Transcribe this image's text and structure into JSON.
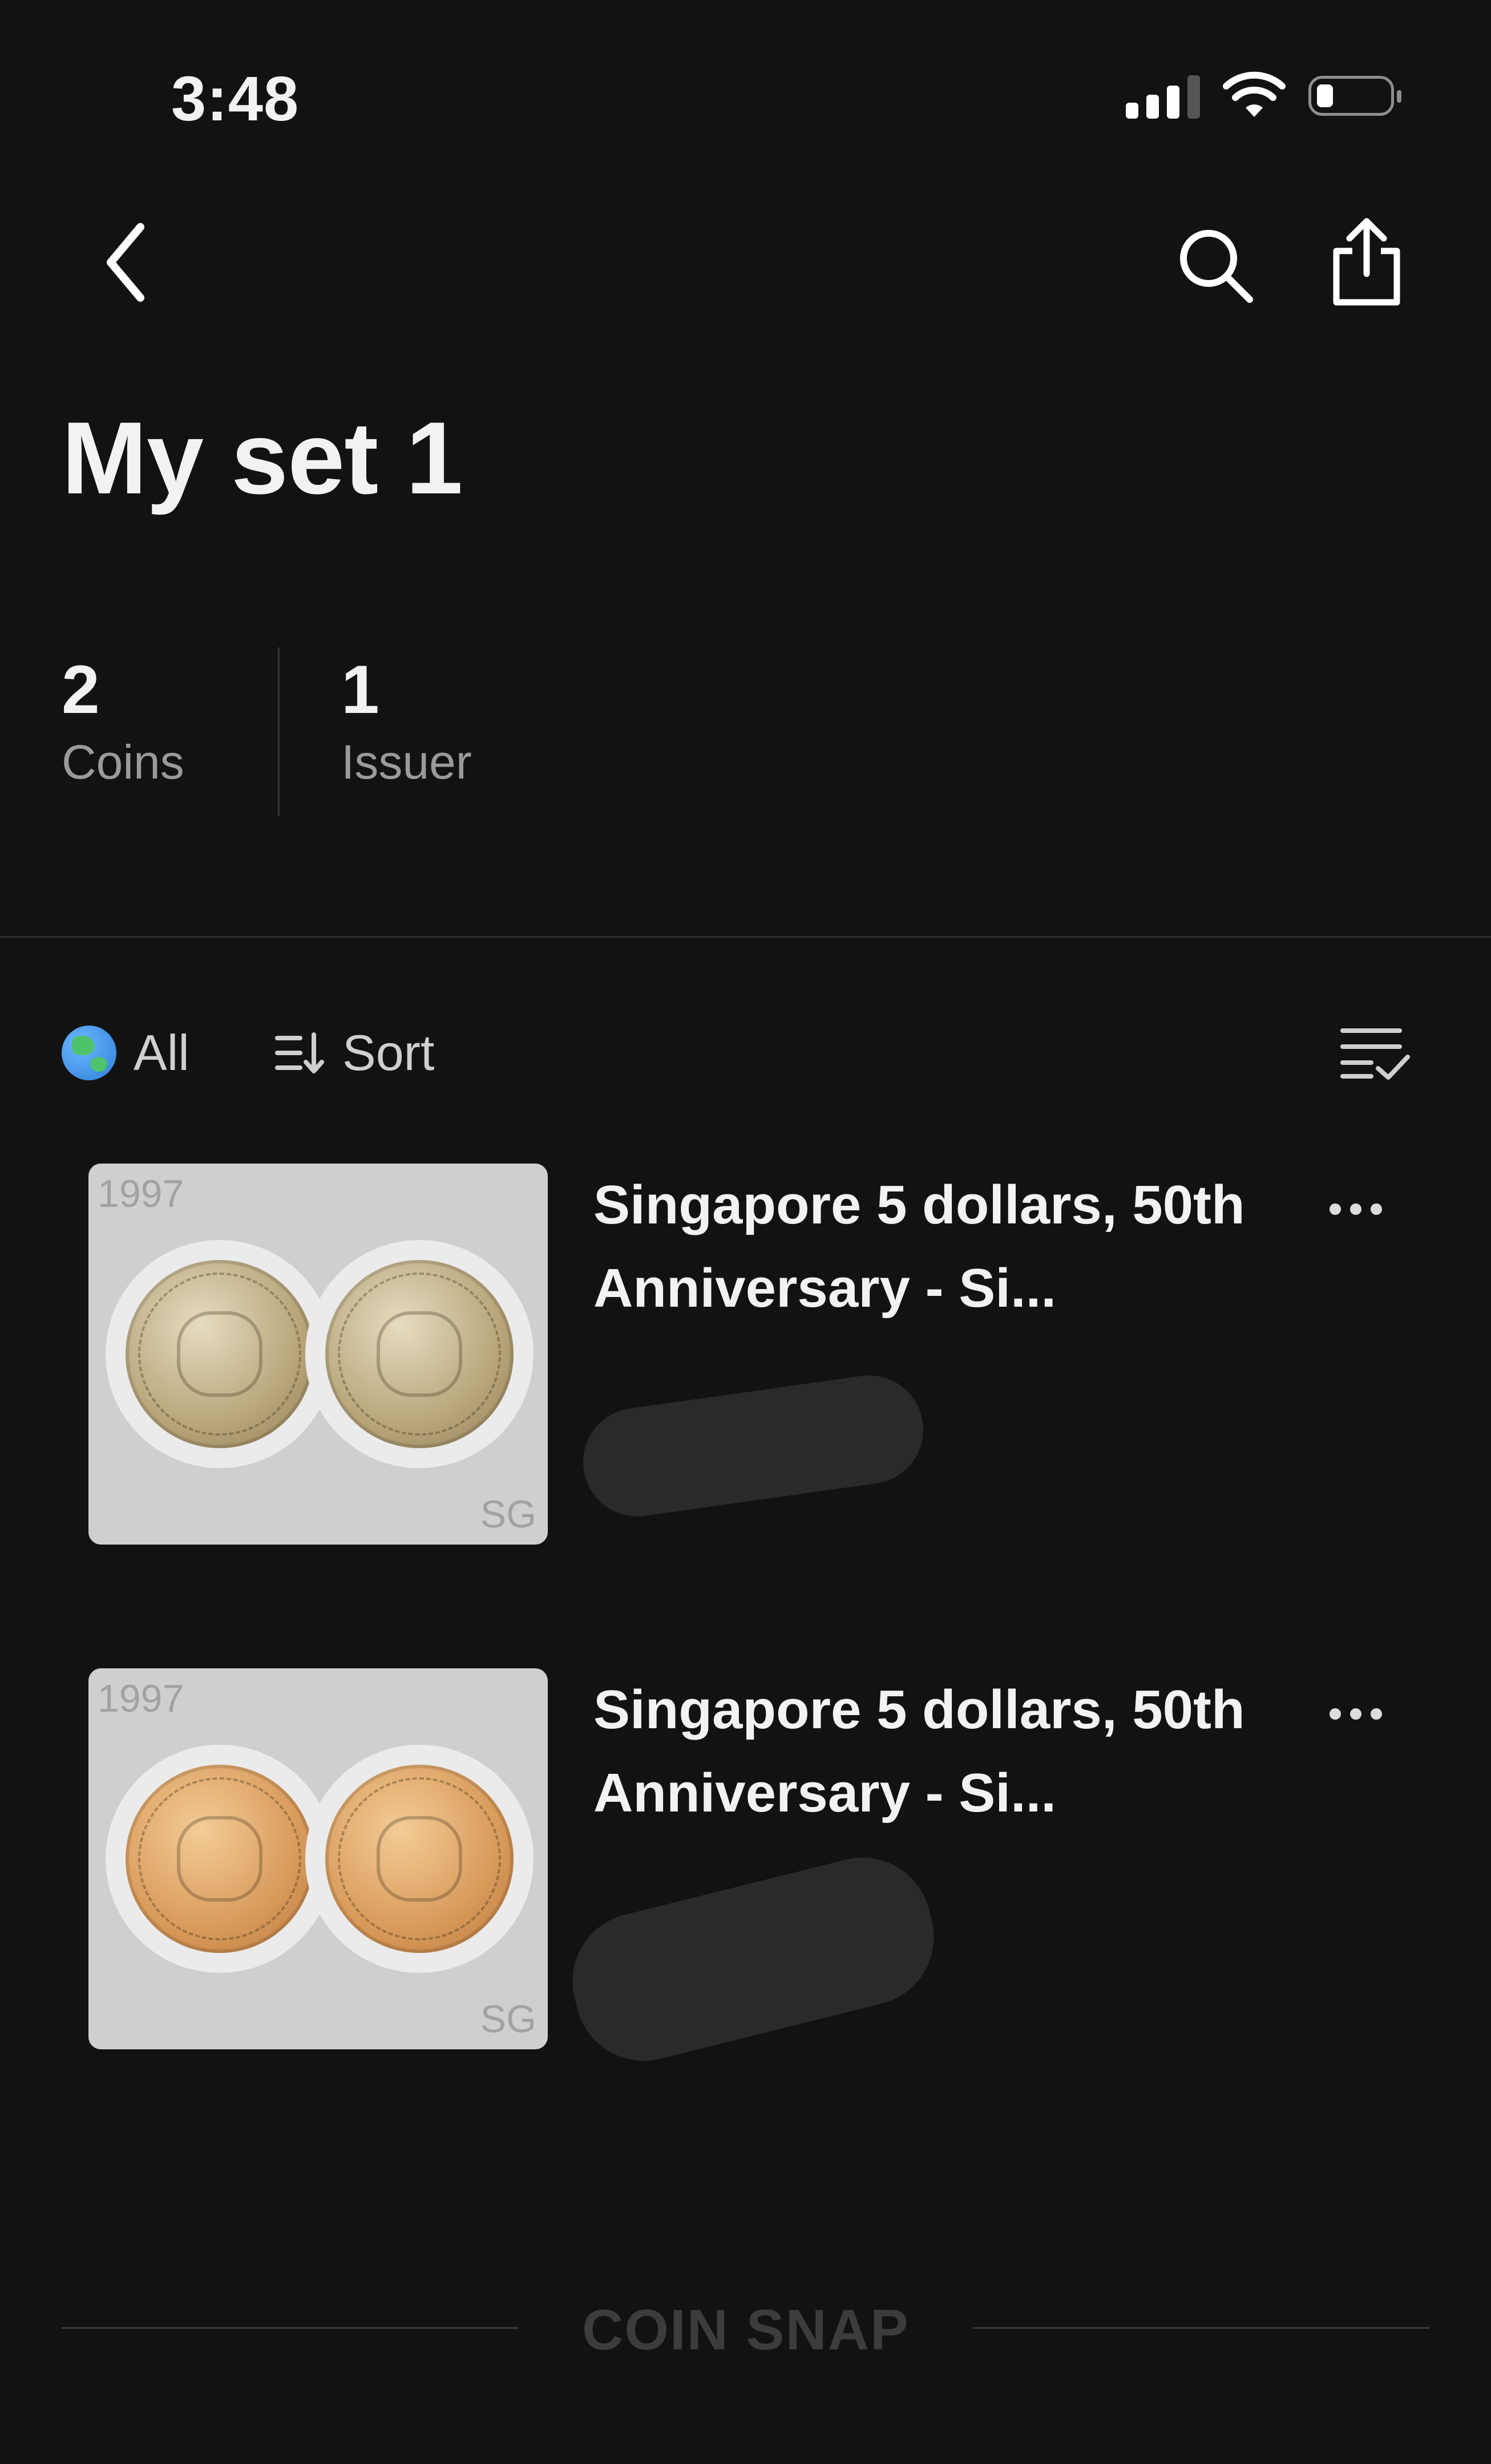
{
  "status_bar": {
    "time": "3:48"
  },
  "header": {
    "title": "My set 1"
  },
  "stats": [
    {
      "value": "2",
      "label": "Coins"
    },
    {
      "value": "1",
      "label": "Issuer"
    }
  ],
  "filters": {
    "region_label": "All",
    "sort_label": "Sort"
  },
  "items": [
    {
      "year": "1997",
      "country": "SG",
      "title": "Singapore 5 dollars, 50th Anniversary - Si...",
      "coin_color": "silver"
    },
    {
      "year": "1997",
      "country": "SG",
      "title": "Singapore 5 dollars, 50th Anniversary - Si...",
      "coin_color": "gold"
    }
  ],
  "footer": {
    "brand": "COIN SNAP"
  },
  "colors": {
    "background": "#121212",
    "text": "#f2f2f2",
    "muted": "#9a9a9a",
    "thumb_bg": "#cfcfcf"
  }
}
